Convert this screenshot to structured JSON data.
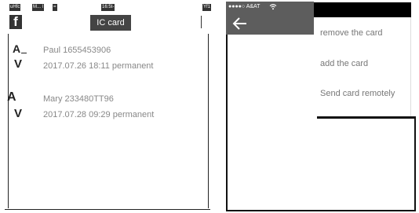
{
  "left": {
    "status": {
      "carrier": "uHfc",
      "signal": "M... l",
      "icon": "=",
      "time": "16:5t-",
      "battery": "Yf1"
    },
    "header": {
      "back_label": "f",
      "title": "IC card"
    },
    "records": [
      {
        "letter_a": "A",
        "letter_b": "V",
        "name_line": "Paul  1655453906",
        "date": "2017.07.26  18:11",
        "status": "permanent"
      },
      {
        "letter_a": "A",
        "letter_b": "V",
        "name_line": "Mary  233480TT96",
        "date": "2017.07.28  09:29",
        "status": "permanent"
      }
    ]
  },
  "right": {
    "status": {
      "carrier": "●●●●○  A&AT",
      "wifi_icon": "wifi-icon"
    },
    "header": {
      "back_icon": "arrow-left-icon"
    },
    "menu": {
      "items": [
        "remove the card",
        "add the card",
        "Send card remotely"
      ]
    }
  }
}
